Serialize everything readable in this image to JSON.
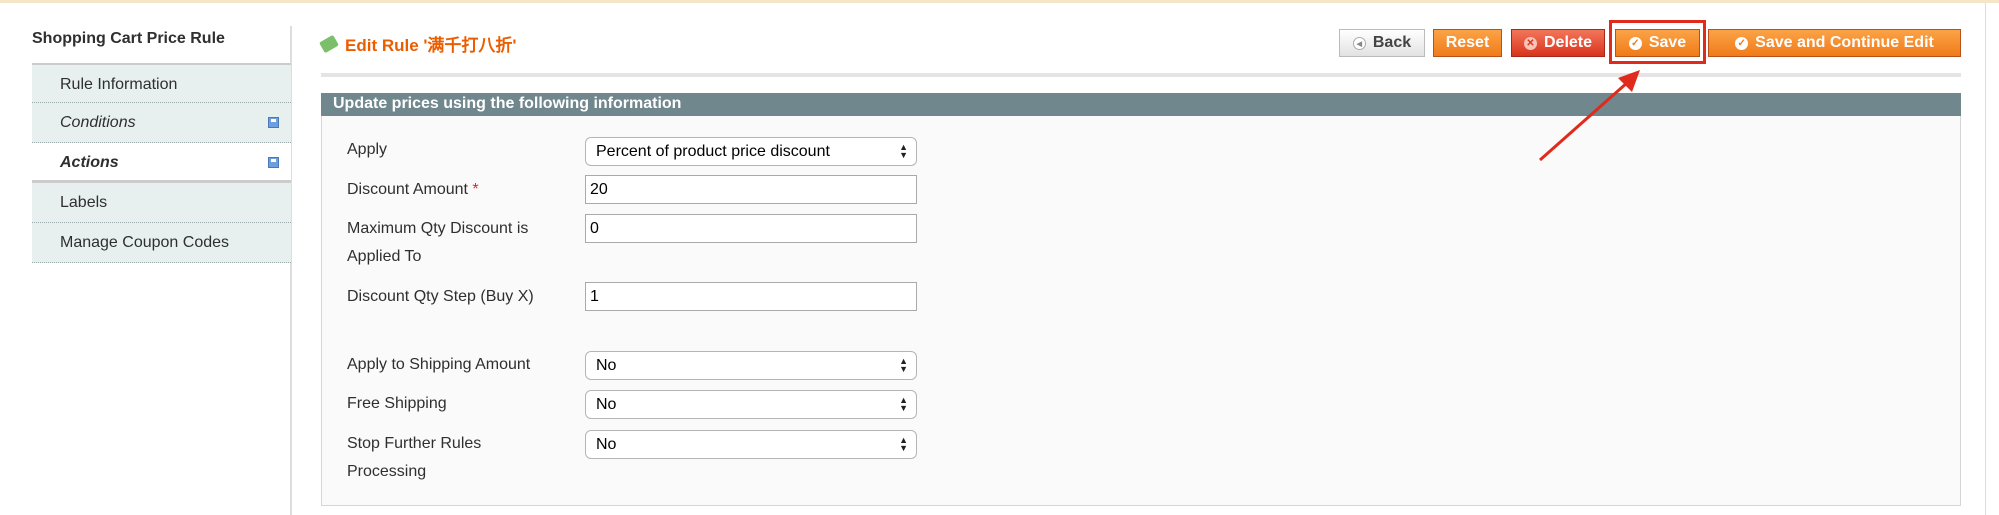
{
  "sidebar": {
    "title": "Shopping Cart Price Rule",
    "items": [
      {
        "label": "Rule Information"
      },
      {
        "label": "Conditions"
      },
      {
        "label": "Actions"
      },
      {
        "label": "Labels"
      },
      {
        "label": "Manage Coupon Codes"
      }
    ]
  },
  "header": {
    "title": "Edit Rule '满千打八折'"
  },
  "buttons": {
    "back": "Back",
    "reset": "Reset",
    "delete": "Delete",
    "save": "Save",
    "save_continue": "Save and Continue Edit"
  },
  "section": {
    "title": "Update prices using the following information"
  },
  "form": {
    "apply": {
      "label": "Apply",
      "value": "Percent of product price discount"
    },
    "discount_amount": {
      "label": "Discount Amount",
      "required": "*",
      "value": "20"
    },
    "max_qty": {
      "label": "Maximum Qty Discount is Applied To",
      "value": "0"
    },
    "qty_step": {
      "label": "Discount Qty Step (Buy X)",
      "value": "1"
    },
    "apply_shipping": {
      "label": "Apply to Shipping Amount",
      "value": "No"
    },
    "free_shipping": {
      "label": "Free Shipping",
      "value": "No"
    },
    "stop_rules": {
      "label": "Stop Further Rules Processing",
      "value": "No"
    }
  },
  "colors": {
    "accent": "#eb5e00",
    "section_header": "#6f878d",
    "highlight": "#e02a1c"
  }
}
